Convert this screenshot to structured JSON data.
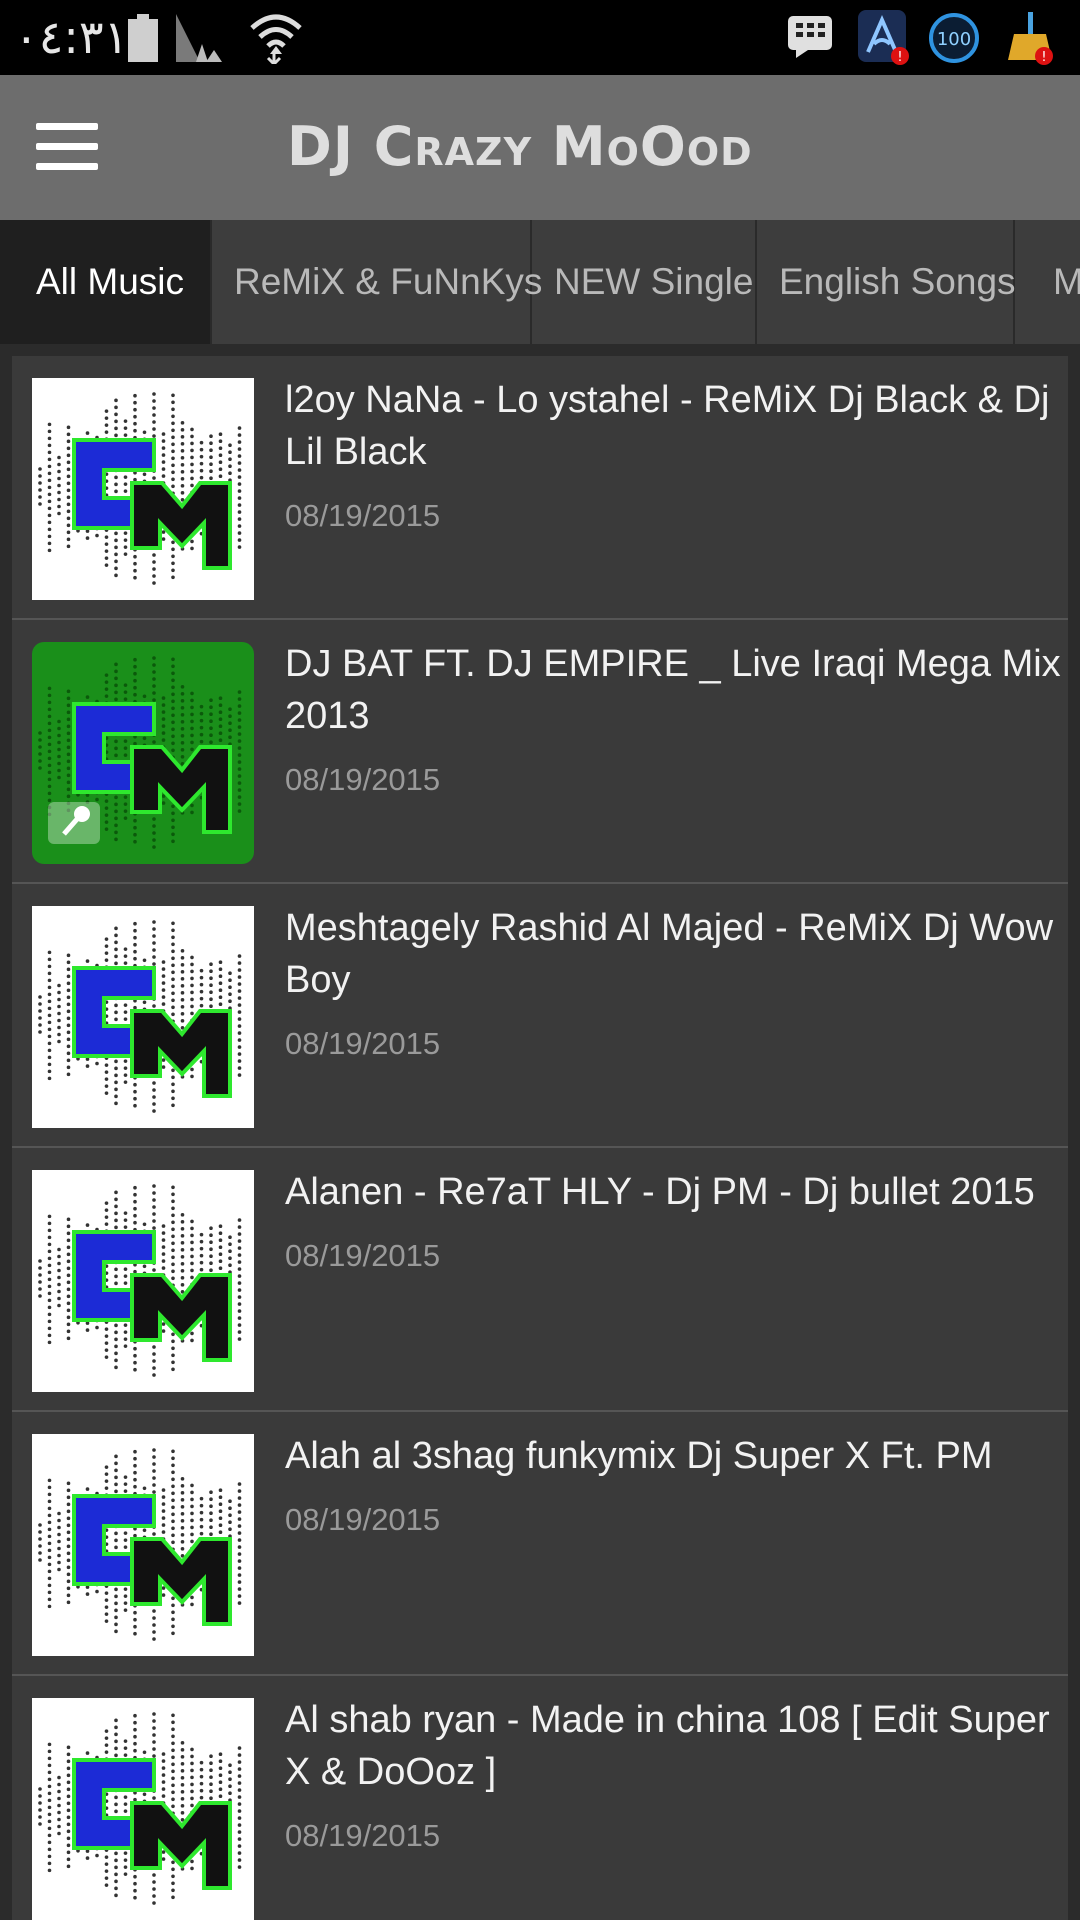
{
  "status_bar": {
    "time": "٠٤:٣١",
    "icons": [
      "battery-icon",
      "signal-icon",
      "wifi-icon",
      "bbm-icon",
      "app-alert-icon",
      "score-100-icon",
      "cleaner-alert-icon"
    ],
    "badge_value": "100"
  },
  "header": {
    "title": "DJ Crazy MoOod",
    "menu_icon": "hamburger-menu-icon"
  },
  "tabs": [
    {
      "label": "All Music",
      "active": true
    },
    {
      "label": "ReMiX & FuNnKys",
      "active": false
    },
    {
      "label": "NEW Single",
      "active": false
    },
    {
      "label": "English Songs",
      "active": false
    },
    {
      "label": "M",
      "active": false
    }
  ],
  "songs": [
    {
      "title": "l2oy NaNa - Lo ystahel - ReMiX Dj Black & Dj Lil Black",
      "date": "08/19/2015",
      "thumb": "cm-logo-white"
    },
    {
      "title": "DJ BAT FT. DJ EMPIRE _ Live Iraqi Mega Mix 2013",
      "date": "08/19/2015",
      "thumb": "cm-logo-green"
    },
    {
      "title": "Meshtagely Rashid Al Majed - ReMiX Dj Wow Boy",
      "date": "08/19/2015",
      "thumb": "cm-logo-white"
    },
    {
      "title": "Alanen - Re7aT HLY - Dj PM - Dj bullet 2015",
      "date": "08/19/2015",
      "thumb": "cm-logo-white"
    },
    {
      "title": "Alah al 3shag funkymix Dj Super X Ft. PM",
      "date": "08/19/2015",
      "thumb": "cm-logo-white"
    },
    {
      "title": "Al shab ryan - Made in china 108 [ Edit Super X  & DoOoz ]",
      "date": "08/19/2015",
      "thumb": "cm-logo-white"
    }
  ],
  "colors": {
    "status_bar_bg": "#000000",
    "app_bar_bg": "#6d6d6d",
    "tab_bar_bg": "#3d3d3d",
    "active_tab_bg": "#1f1f1f",
    "list_bg": "#3a3a3a",
    "logo_blue": "#1c2bd6",
    "logo_green_outline": "#2ee82e"
  }
}
